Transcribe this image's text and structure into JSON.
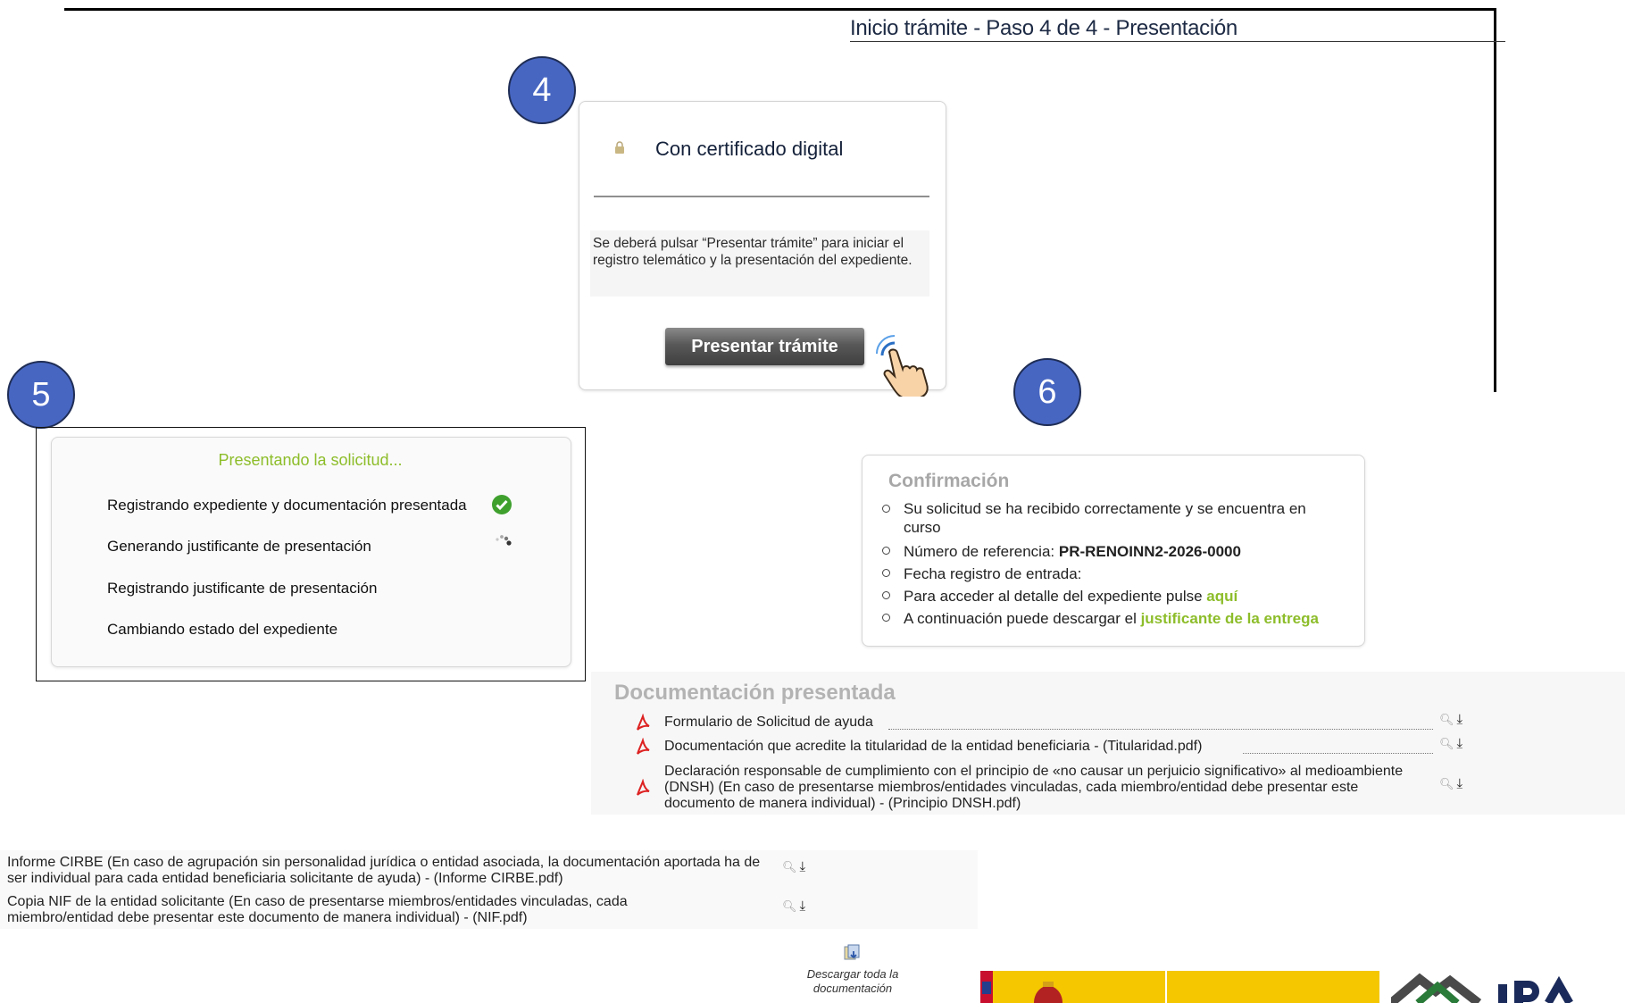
{
  "step4": {
    "badge": "4",
    "window_title": "Inicio trámite - Paso 4 de 4 - Presentación",
    "card_title": "Con certificado digital",
    "card_text": "Se deberá pulsar “Presentar trámite” para iniciar el registro telemático y la presentación del expediente.",
    "button_label": "Presentar trámite"
  },
  "step5": {
    "badge": "5",
    "title": "Presentando la solicitud...",
    "steps": [
      {
        "label": "Registrando expediente y documentación presentada",
        "status": "done"
      },
      {
        "label": "Generando justificante de presentación",
        "status": "in-progress"
      },
      {
        "label": "Registrando justificante de presentación",
        "status": "pending"
      },
      {
        "label": "Cambiando estado del expediente",
        "status": "pending"
      }
    ]
  },
  "step6": {
    "badge": "6",
    "title": "Confirmación",
    "items": {
      "received": "Su solicitud se ha recibido correctamente y se encuentra en curso",
      "ref_label": "Número de referencia: ",
      "ref_value": "PR-RENOINN2-2026-0000",
      "date_label": "Fecha registro de entrada:",
      "detail_text": "Para acceder al detalle del expediente pulse ",
      "detail_link": "aquí",
      "download_text": "A continuación puede descargar el ",
      "download_link": "justificante de la entrega"
    }
  },
  "documents": {
    "title": "Documentación presentada",
    "items": [
      "Formulario de Solicitud de ayuda",
      "Documentación que acredite la titularidad de la entidad beneficiaria - (Titularidad.pdf)",
      "Declaración responsable de cumplimiento con el principio de «no causar un perjuicio significativo» al medioambiente (DNSH) (En caso de presentarse miembros/entidades vinculadas, cada miembro/entidad debe presentar este documento de manera individual) - (Principio DNSH.pdf)"
    ],
    "extra_items": [
      "Informe CIRBE (En caso de agrupación sin personalidad jurídica o entidad asociada, la documentación aportada ha de ser individual para cada entidad beneficiaria solicitante de ayuda) - (Informe CIRBE.pdf)",
      "Copia NIF de la entidad solicitante (En caso de presentarse miembros/entidades vinculadas, cada miembro/entidad debe presentar este documento de manera individual) - (NIF.pdf)"
    ],
    "download_all": "Descargar toda la documentación"
  },
  "colors": {
    "badge": "#4766c2",
    "accent_green": "#8dbd2a",
    "header_navy": "#1d2a44"
  },
  "icons": [
    "lock-icon",
    "hand-pointer-icon",
    "check-circle-icon",
    "spinner-icon",
    "pdf-icon",
    "magnifier-icon",
    "download-icon",
    "download-all-icon"
  ]
}
